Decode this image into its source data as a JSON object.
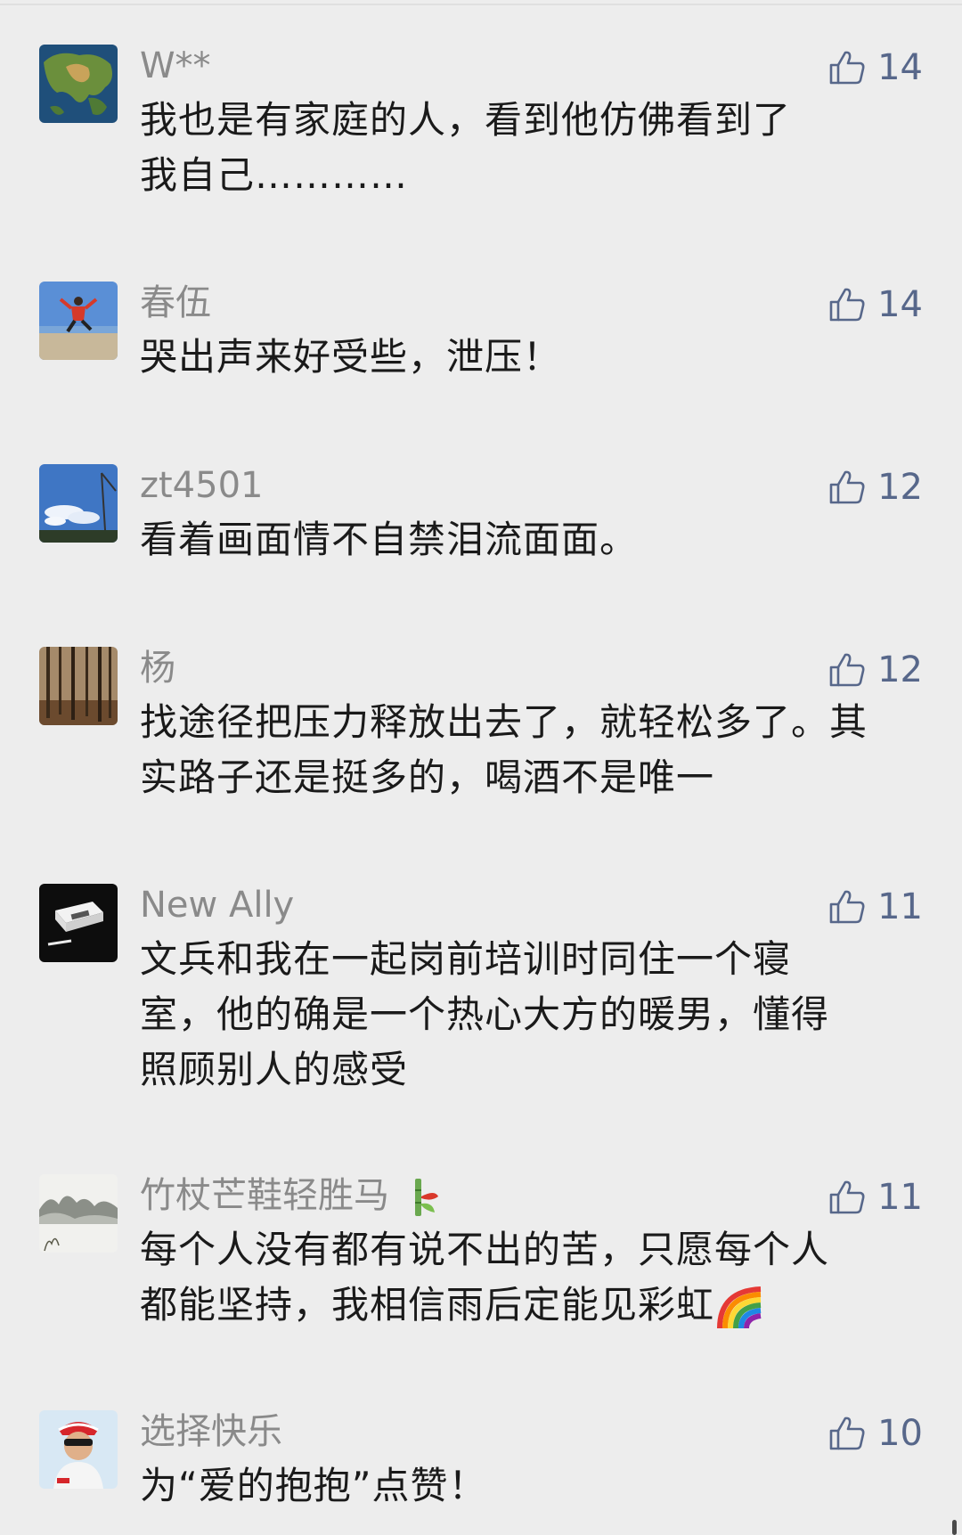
{
  "colors": {
    "background": "#ededed",
    "nickname": "#8a8a8a",
    "like_accent": "#57678a",
    "content_text": "#1a1a1a"
  },
  "comments": [
    {
      "nickname": "W**",
      "likes": "14",
      "content": "我也是有家庭的人，看到他仿佛看到了我自己…………",
      "avatar": "earth-map-avatar"
    },
    {
      "nickname": "春伍",
      "likes": "14",
      "content": "哭出声来好受些，泄压！",
      "avatar": "beach-jump-avatar"
    },
    {
      "nickname": "zt4501",
      "likes": "12",
      "content": "看着画面情不自禁泪流面面。",
      "avatar": "sky-clouds-avatar"
    },
    {
      "nickname": "杨",
      "likes": "12",
      "content": "找途径把压力释放出去了，就轻松多了。其实路子还是挺多的，喝酒不是唯一",
      "avatar": "forest-avatar"
    },
    {
      "nickname": "New Ally",
      "likes": "11",
      "content": "文兵和我在一起岗前培训时同住一个寝室，他的确是一个热心大方的暖男，懂得照顾别人的感受",
      "avatar": "cigarette-box-avatar"
    },
    {
      "nickname": "竹杖芒鞋轻胜马",
      "likes": "11",
      "content": "每个人没有都有说不出的苦，只愿每个人都能坚持，我相信雨后定能见彩虹",
      "avatar": "ink-landscape-avatar",
      "nickname_emoji": "bamboo-emoji",
      "content_emoji": "rainbow-emoji"
    },
    {
      "nickname": "选择快乐",
      "likes": "10",
      "content": "为“爱的抱抱”点赞！",
      "avatar": "cyclist-avatar"
    }
  ]
}
